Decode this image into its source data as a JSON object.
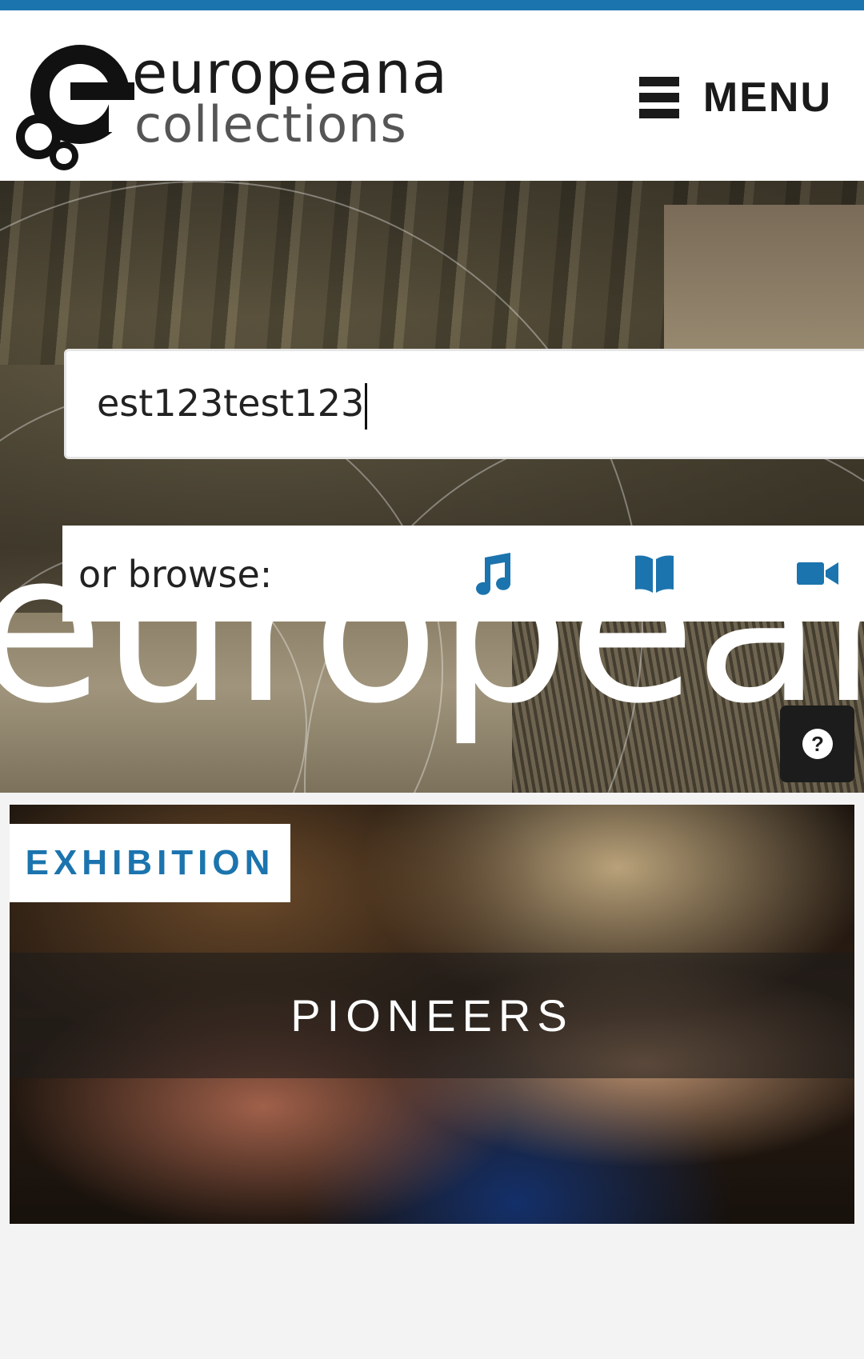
{
  "header": {
    "logo_line1": "europeana",
    "logo_line2": "collections",
    "menu_label": "MENU"
  },
  "hero": {
    "background_word": "europeana",
    "search_value": "est123test123",
    "browse_label": "or browse:",
    "browse_icons": [
      "music-icon",
      "book-icon",
      "video-icon"
    ],
    "help_icon": "question-circle-icon"
  },
  "feature": {
    "tag_label": "EXHIBITION",
    "title": "PIONEERS"
  },
  "colors": {
    "accent": "#1b74ae",
    "top_bar": "#1b74ae",
    "page_background": "#f3f3f3"
  }
}
